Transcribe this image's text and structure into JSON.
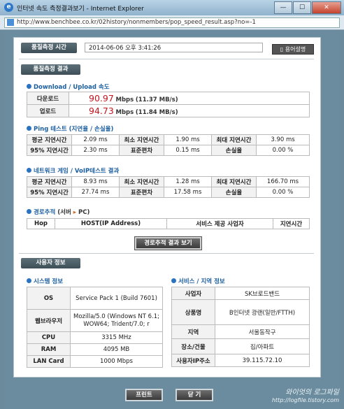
{
  "window": {
    "title": "인터넷 속도 측정결과보기 - Internet Explorer",
    "buttons": {
      "minimize": "—",
      "maximize": "☐",
      "close": "✕"
    }
  },
  "address": {
    "url": "http://www.benchbee.co.kr/02history/nonmembers/pop_speed_result.asp?no=-1"
  },
  "measure_time": {
    "label": "품질측정 시간",
    "value": "2014-06-06 오후 3:41:26",
    "help_button": "▯ 용어설명"
  },
  "results_label": "품질측정 결과",
  "speed": {
    "title": "Download / Upload 속도",
    "download": {
      "label": "다운로드",
      "value": "90.97",
      "unit": "Mbps",
      "sub": "(11.37 MB/s)"
    },
    "upload": {
      "label": "업로드",
      "value": "94.73",
      "unit": "Mbps",
      "sub": "(11.84 MB/s)"
    }
  },
  "ping": {
    "title": "Ping 테스트",
    "title_sub": "(지연율 / 손실율)",
    "rows": [
      [
        "평균 지연시간",
        "2.09 ms",
        "최소 지연시간",
        "1.90 ms",
        "최대 지연시간",
        "3.90 ms"
      ],
      [
        "95% 지연시간",
        "2.30 ms",
        "표준편차",
        "0.15 ms",
        "손실율",
        "0.00 %"
      ]
    ]
  },
  "game": {
    "title": "네트워크 게임 / VoIP테스트 결과",
    "rows": [
      [
        "평균 지연시간",
        "8.93 ms",
        "최소 지연시간",
        "1.28 ms",
        "최대 지연시간",
        "166.70 ms"
      ],
      [
        "95% 지연시간",
        "27.74 ms",
        "표준편차",
        "17.58 ms",
        "손실율",
        "0.00 %"
      ]
    ]
  },
  "route": {
    "title": "경로추적",
    "title_pre": "(서버",
    "title_arrow": "▸",
    "title_post": "PC)",
    "headers": [
      "Hop",
      "HOST(IP Address)",
      "서비스 제공 사업자",
      "지연시간"
    ],
    "button": "경로추적 결과 보기"
  },
  "user_info_label": "사용자 정보",
  "system": {
    "title": "시스템 정보",
    "rows": [
      [
        "OS",
        "Service Pack 1 (Build 7601)"
      ],
      [
        "웹브라우저",
        "Mozilla/5.0 (Windows NT 6.1;\nWOW64; Trident/7.0; r"
      ],
      [
        "CPU",
        "3315 MHz"
      ],
      [
        "RAM",
        "4095 MB"
      ],
      [
        "LAN Card",
        "1000 Mbps"
      ]
    ]
  },
  "service": {
    "title": "서비스 / 지역 정보",
    "rows": [
      [
        "사업자",
        "SK브로드밴드"
      ],
      [
        "상품명",
        "B인터넷 광랜(일반/FTTH)"
      ],
      [
        "지역",
        "서울동작구"
      ],
      [
        "장소/건물",
        "집/아파트"
      ],
      [
        "사용자IP주소",
        "39.115.72.10"
      ]
    ]
  },
  "bottom": {
    "print": "프린트",
    "close": "닫 기"
  },
  "watermark": {
    "line1": "와이엇의 로그파일",
    "line2": "http://logfile.tistory.com"
  },
  "colors": {
    "accent": "#1c5fa0",
    "speed": "#c4141e",
    "frame": "#6a8c9e"
  }
}
